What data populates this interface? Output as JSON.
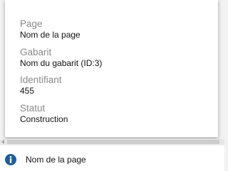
{
  "popup": {
    "fields": [
      {
        "label": "Page",
        "value": "Nom de la page"
      },
      {
        "label": "Gabarit",
        "value": "Nom du gabarit (ID:3)"
      },
      {
        "label": "Identifiant",
        "value": "455"
      },
      {
        "label": "Statut",
        "value": "Construction"
      }
    ]
  },
  "status": {
    "icon": "info-icon",
    "text": "Nom de la page"
  },
  "colors": {
    "label": "#8a8a8a",
    "value": "#111111",
    "info_icon": "#1f5c99",
    "background": "#f2f2f2"
  }
}
